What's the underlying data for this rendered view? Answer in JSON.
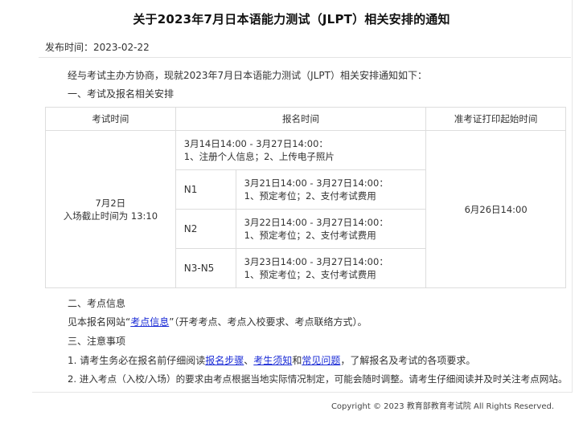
{
  "notice": {
    "title": "关于2023年7月日本语能力测试（JLPT）相关安排的通知",
    "pubdate": "发布时间：2023-02-22",
    "intro": "经与考试主办方协商，现就2023年7月日本语能力测试（JLPT）相关安排通知如下：",
    "section1": "一、考试及报名相关安排",
    "section2": "二、考点信息",
    "section3": "三、注意事项",
    "site_prefix": "见本报名网站“",
    "site_link": "考点信息",
    "site_suffix": "”（开考考点、考点入校要求、考点联络方式）。",
    "note1_prefix": "1. 请考生务必在报名前仔细阅读",
    "note1_link1": "报名步骤",
    "note1_sep": "、",
    "note1_link2": "考生须知",
    "note1_and": "和",
    "note1_link3": "常见问题",
    "note1_suffix": "，了解报名及考试的各项要求。",
    "note2": "2. 进入考点（入校/入场）的要求由考点根据当地实际情况制定，可能会随时调整。请考生仔细阅读并及时关注考点网站。"
  },
  "table": {
    "headers": [
      "考试时间",
      "报名时间",
      "准考证打印起始时间"
    ],
    "exam_date": "7月2日",
    "exam_cutoff": "入场截止时间为 13:10",
    "reg_general_time": "3月14日14:00 - 3月27日14:00：",
    "reg_general_steps": "1、注册个人信息；2、上传电子照片",
    "rows": [
      {
        "level": "N1",
        "time": "3月21日14:00 - 3月27日14:00：",
        "steps": "1、预定考位；2、支付考试费用"
      },
      {
        "level": "N2",
        "time": "3月22日14:00 - 3月27日14:00：",
        "steps": "1、预定考位；2、支付考试费用"
      },
      {
        "level": "N3-N5",
        "time": "3月23日14:00 - 3月27日14:00：",
        "steps": "1、预定考位；2、支付考试费用"
      }
    ],
    "print_start": "6月26日14:00"
  },
  "footer": {
    "copyright": "Copyright © 2023 教育部教育考试院 All Rights Reserved."
  }
}
